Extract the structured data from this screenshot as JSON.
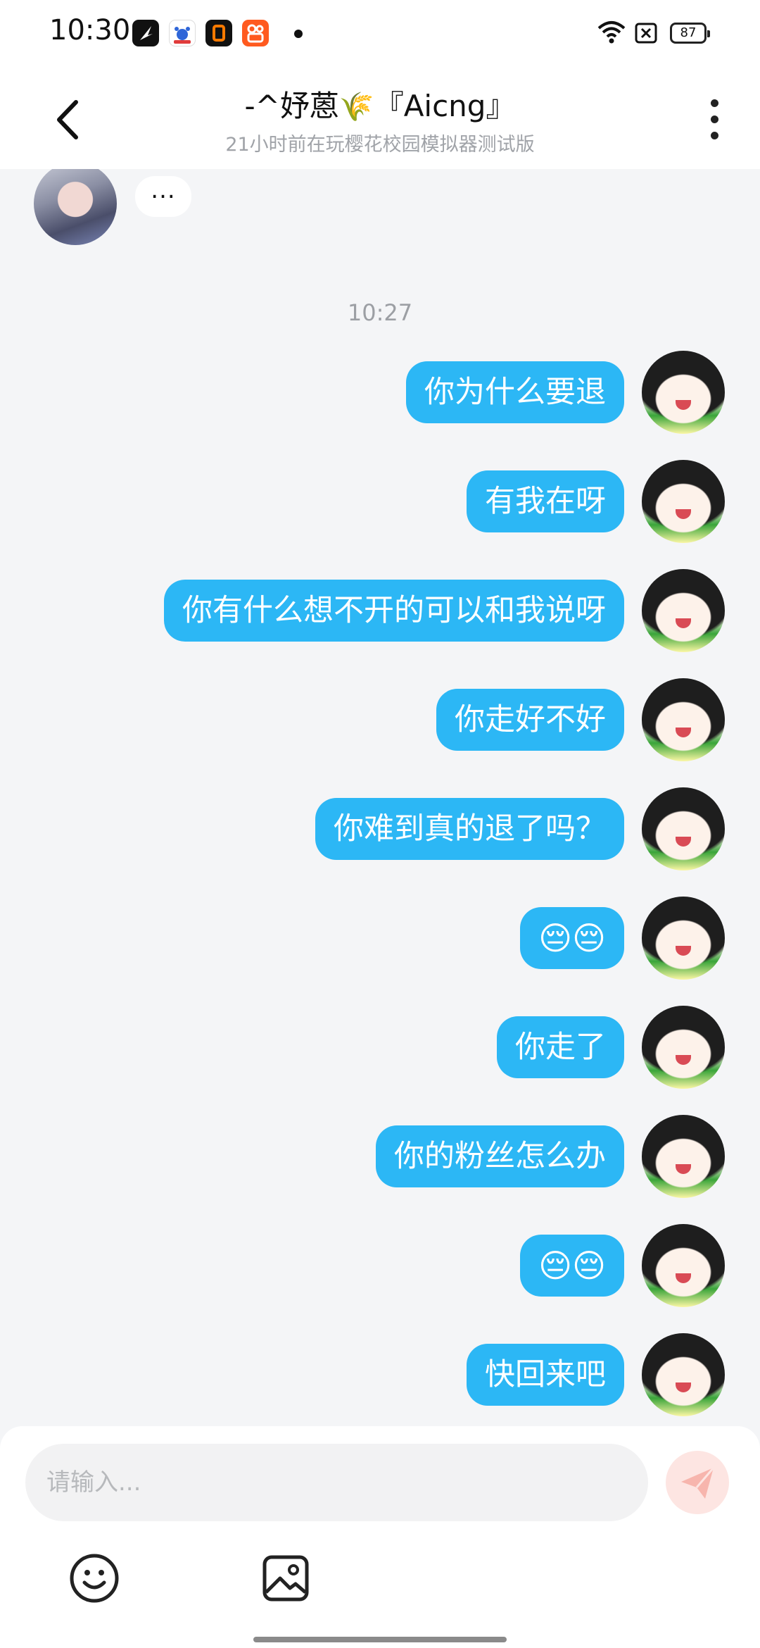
{
  "status_bar": {
    "time": "10:30",
    "battery": "87",
    "icons": [
      "app-icon-feather",
      "baidu-icon",
      "app-icon-orange-square",
      "kuaishou-icon",
      "wifi-icon",
      "sim-off-icon"
    ]
  },
  "header": {
    "title_prefix": "-^妤蒽",
    "title_emoji": "🌾",
    "title_suffix": "『Aicng』",
    "subtitle": "21小时前在玩樱花校园模拟器测试版"
  },
  "chat": {
    "typing_indicator": "...",
    "timestamp": "10:27",
    "messages": [
      {
        "text": "你为什么要退"
      },
      {
        "text": "有我在呀"
      },
      {
        "text": "你有什么想不开的可以和我说呀"
      },
      {
        "text": "你走好不好"
      },
      {
        "text": "你难到真的退了吗？"
      },
      {
        "text": "😔😔"
      },
      {
        "text": "你走了"
      },
      {
        "text": "你的粉丝怎么办"
      },
      {
        "text": "😔😔"
      },
      {
        "text": "快回来吧"
      }
    ]
  },
  "input": {
    "placeholder": "请输入..."
  },
  "colors": {
    "accent_bubble": "#2cb7f5",
    "background": "#f4f5f7",
    "send_button": "#fde5e2"
  }
}
